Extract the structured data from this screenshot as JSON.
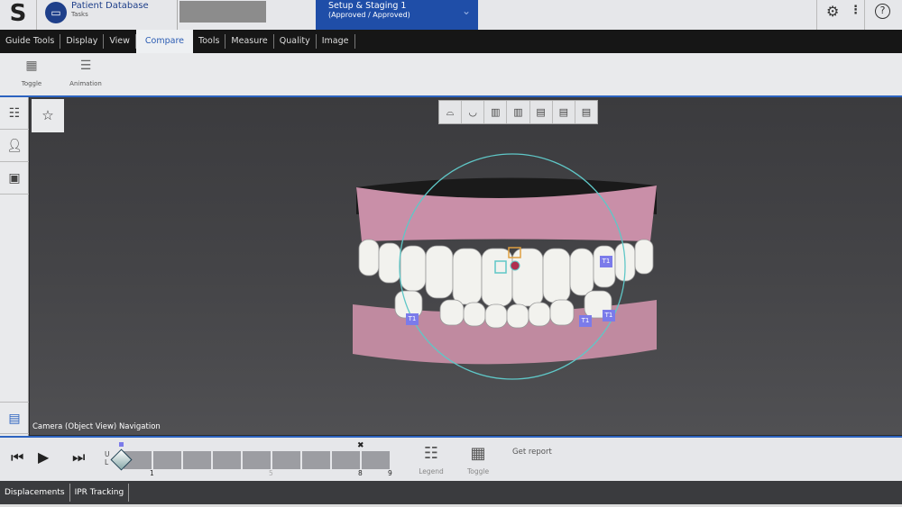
{
  "header": {
    "patient_database": "Patient Database",
    "tasks": "Tasks",
    "stage_title": "Setup & Staging 1",
    "stage_status": "(Approved / Approved)",
    "help": "?"
  },
  "tabs": [
    "Guide Tools",
    "Display",
    "View",
    "Compare",
    "Tools",
    "Measure",
    "Quality",
    "Image"
  ],
  "active_tab": "Compare",
  "ribbon": {
    "toggle": "Toggle",
    "animation": "Animation"
  },
  "viewport": {
    "status": "Camera (Object View) Navigation",
    "tooth_label": "T1"
  },
  "timeline": {
    "upper": "U",
    "lower": "L",
    "ticks": [
      "1",
      "5",
      "8",
      "9"
    ],
    "legend": "Legend",
    "toggle": "Toggle",
    "get_report": "Get report"
  },
  "bottom_tabs": [
    "Displacements",
    "IPR Tracking"
  ],
  "colors": {
    "accent": "#1f4ea8",
    "gum": "#c98fa8",
    "marker": "#7b7bea",
    "circle": "#5fc7c7"
  }
}
